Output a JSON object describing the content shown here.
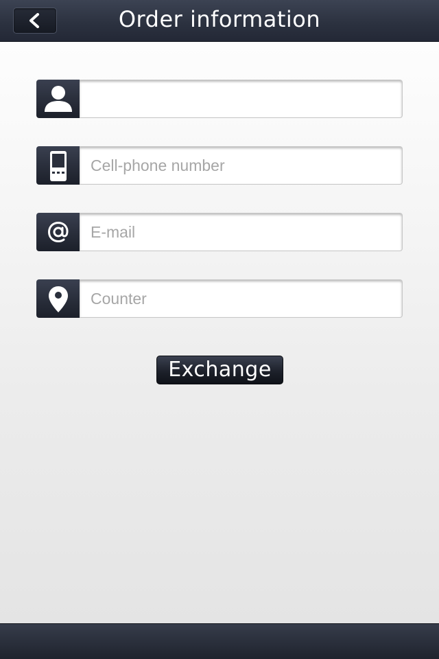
{
  "header": {
    "title": "Order information",
    "back_icon": "chevron-left-icon"
  },
  "form": {
    "fields": [
      {
        "icon": "person-icon",
        "value": "",
        "placeholder": ""
      },
      {
        "icon": "phone-icon",
        "value": "",
        "placeholder": "Cell-phone number"
      },
      {
        "icon": "at-sign-icon",
        "value": "",
        "placeholder": "E-mail"
      },
      {
        "icon": "location-pin-icon",
        "value": "",
        "placeholder": "Counter"
      }
    ],
    "submit_label": "Exchange"
  },
  "colors": {
    "bar": "#2c3240",
    "placeholder": "#a6a6a6",
    "background": "#f2f2f2"
  }
}
